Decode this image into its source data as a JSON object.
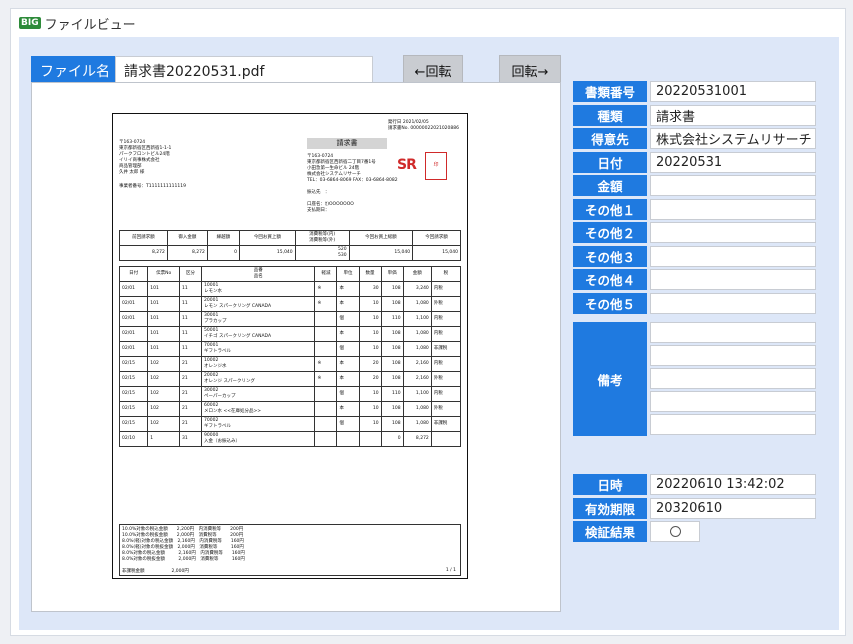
{
  "window": {
    "badge": "BIG",
    "title": "ファイルビュー"
  },
  "file": {
    "label": "ファイル名",
    "name": "請求書20220531.pdf"
  },
  "buttons": {
    "rotate_left": "←回転",
    "rotate_right": "回転→"
  },
  "fields": [
    {
      "label": "書類番号",
      "value": "20220531001"
    },
    {
      "label": "種類",
      "value": "請求書"
    },
    {
      "label": "得意先",
      "value": "株式会社システムリサーチ"
    },
    {
      "label": "日付",
      "value": "20220531"
    },
    {
      "label": "金額",
      "value": ""
    },
    {
      "label": "その他１",
      "value": ""
    },
    {
      "label": "その他２",
      "value": ""
    },
    {
      "label": "その他３",
      "value": ""
    },
    {
      "label": "その他４",
      "value": ""
    },
    {
      "label": "その他５",
      "value": ""
    }
  ],
  "remarks": {
    "label": "備考"
  },
  "meta": [
    {
      "label": "日時",
      "value": "20220610 13:42:02"
    },
    {
      "label": "有効期限",
      "value": "20320610"
    },
    {
      "label": "検証結果",
      "value": ""
    }
  ],
  "doc": {
    "issue": "発行日 2021/02/05",
    "number": "請求書No. 00000022021020886",
    "to_zip": "〒163-0724",
    "to_addr1": "東京都新宿区西新宿1-1-1",
    "to_addr2": "パークフロントビル24階",
    "to_co": "イリイ商事株式会社",
    "to_dept": "商品管理部",
    "to_person": "久井 太郎 様",
    "reg_no": "事業者番号：T1111111111119",
    "title": "請求書",
    "from_zip": "〒163-0724",
    "from_addr": "東京都新宿区西新宿二丁目7番1号",
    "from_bld": "小田急第一生命ビル 24階",
    "from_co": "株式会社システムリサーチ",
    "from_tel": "TEL：03-6864-8069 FAX：03-6864-8082",
    "transfer": "振込先　：",
    "account_name": "口座名：ｶ)OOOOOOO",
    "due": "支払期日：",
    "seal_text": "印",
    "logo": "SR",
    "summary_headers": [
      "前回請求額",
      "御入金額",
      "繰越額",
      "今回お買上額",
      "消費税等(内)\n消費税等(外)",
      "今回お買上総額",
      "今回請求額"
    ],
    "summary_values": [
      "8,272",
      "8,272",
      "0",
      "15,040",
      "520\n530",
      "15,040",
      "15,040"
    ],
    "line_headers": [
      "日付",
      "伝票No",
      "区分",
      "品番\n品名",
      "軽減",
      "単位",
      "数量",
      "単価",
      "金額",
      "税"
    ],
    "lines": [
      [
        "02/01",
        "101",
        "11",
        "10001\nレモン水",
        "※",
        "本",
        "30",
        "108",
        "3,240",
        "内税"
      ],
      [
        "02/01",
        "101",
        "11",
        "20001\nレモン スパークリング CANADA",
        "※",
        "本",
        "10",
        "108",
        "1,080",
        "外税"
      ],
      [
        "02/01",
        "101",
        "11",
        "30001\nプラカップ",
        "",
        "個",
        "10",
        "110",
        "1,100",
        "内税"
      ],
      [
        "02/01",
        "101",
        "11",
        "50001\nイチゴ スパークリング CANADA",
        "",
        "本",
        "10",
        "108",
        "1,080",
        "内税"
      ],
      [
        "02/01",
        "101",
        "11",
        "70001\nギフトラベル",
        "",
        "個",
        "10",
        "108",
        "1,080",
        "非課税"
      ],
      [
        "02/15",
        "102",
        "21",
        "10002\nオレンジ水",
        "※",
        "本",
        "20",
        "108",
        "2,160",
        "内税"
      ],
      [
        "02/15",
        "102",
        "21",
        "20002\nオレンジ スパークリング",
        "※",
        "本",
        "20",
        "108",
        "2,160",
        "外税"
      ],
      [
        "02/15",
        "102",
        "21",
        "30002\nペーパーカップ",
        "",
        "個",
        "10",
        "110",
        "1,100",
        "内税"
      ],
      [
        "02/15",
        "102",
        "21",
        "60002\nメロン水 <<在庫処分品>>",
        "",
        "本",
        "10",
        "108",
        "1,080",
        "外税"
      ],
      [
        "02/15",
        "102",
        "21",
        "70002\nギフトラベル",
        "",
        "個",
        "10",
        "108",
        "1,080",
        "非課税"
      ],
      [
        "02/10",
        "1",
        "31",
        "90000\n入金（お振込み）",
        "",
        "",
        "",
        "0",
        "8,272",
        ""
      ]
    ],
    "tax_summary": [
      "10.0%対象の税込金額　　2,200円　内消費税等　　200円",
      "10.0%対象の税抜金額　　2,000円　消費税等　　　200円",
      "8.0%(軽)対象の税込金額　2,160円　内消費税等　　160円",
      "8.0%(軽)対象の税抜金額　2,000円　消費税等　　　160円",
      "8.0%対象の税込金額　　　2,160円　内消費税等　　160円",
      "8.0%対象の税抜金額　　　2,000円　消費税等　　　160円"
    ],
    "nontax": "非課税金額　　　　　　2,000円",
    "page": "1 / 1"
  }
}
